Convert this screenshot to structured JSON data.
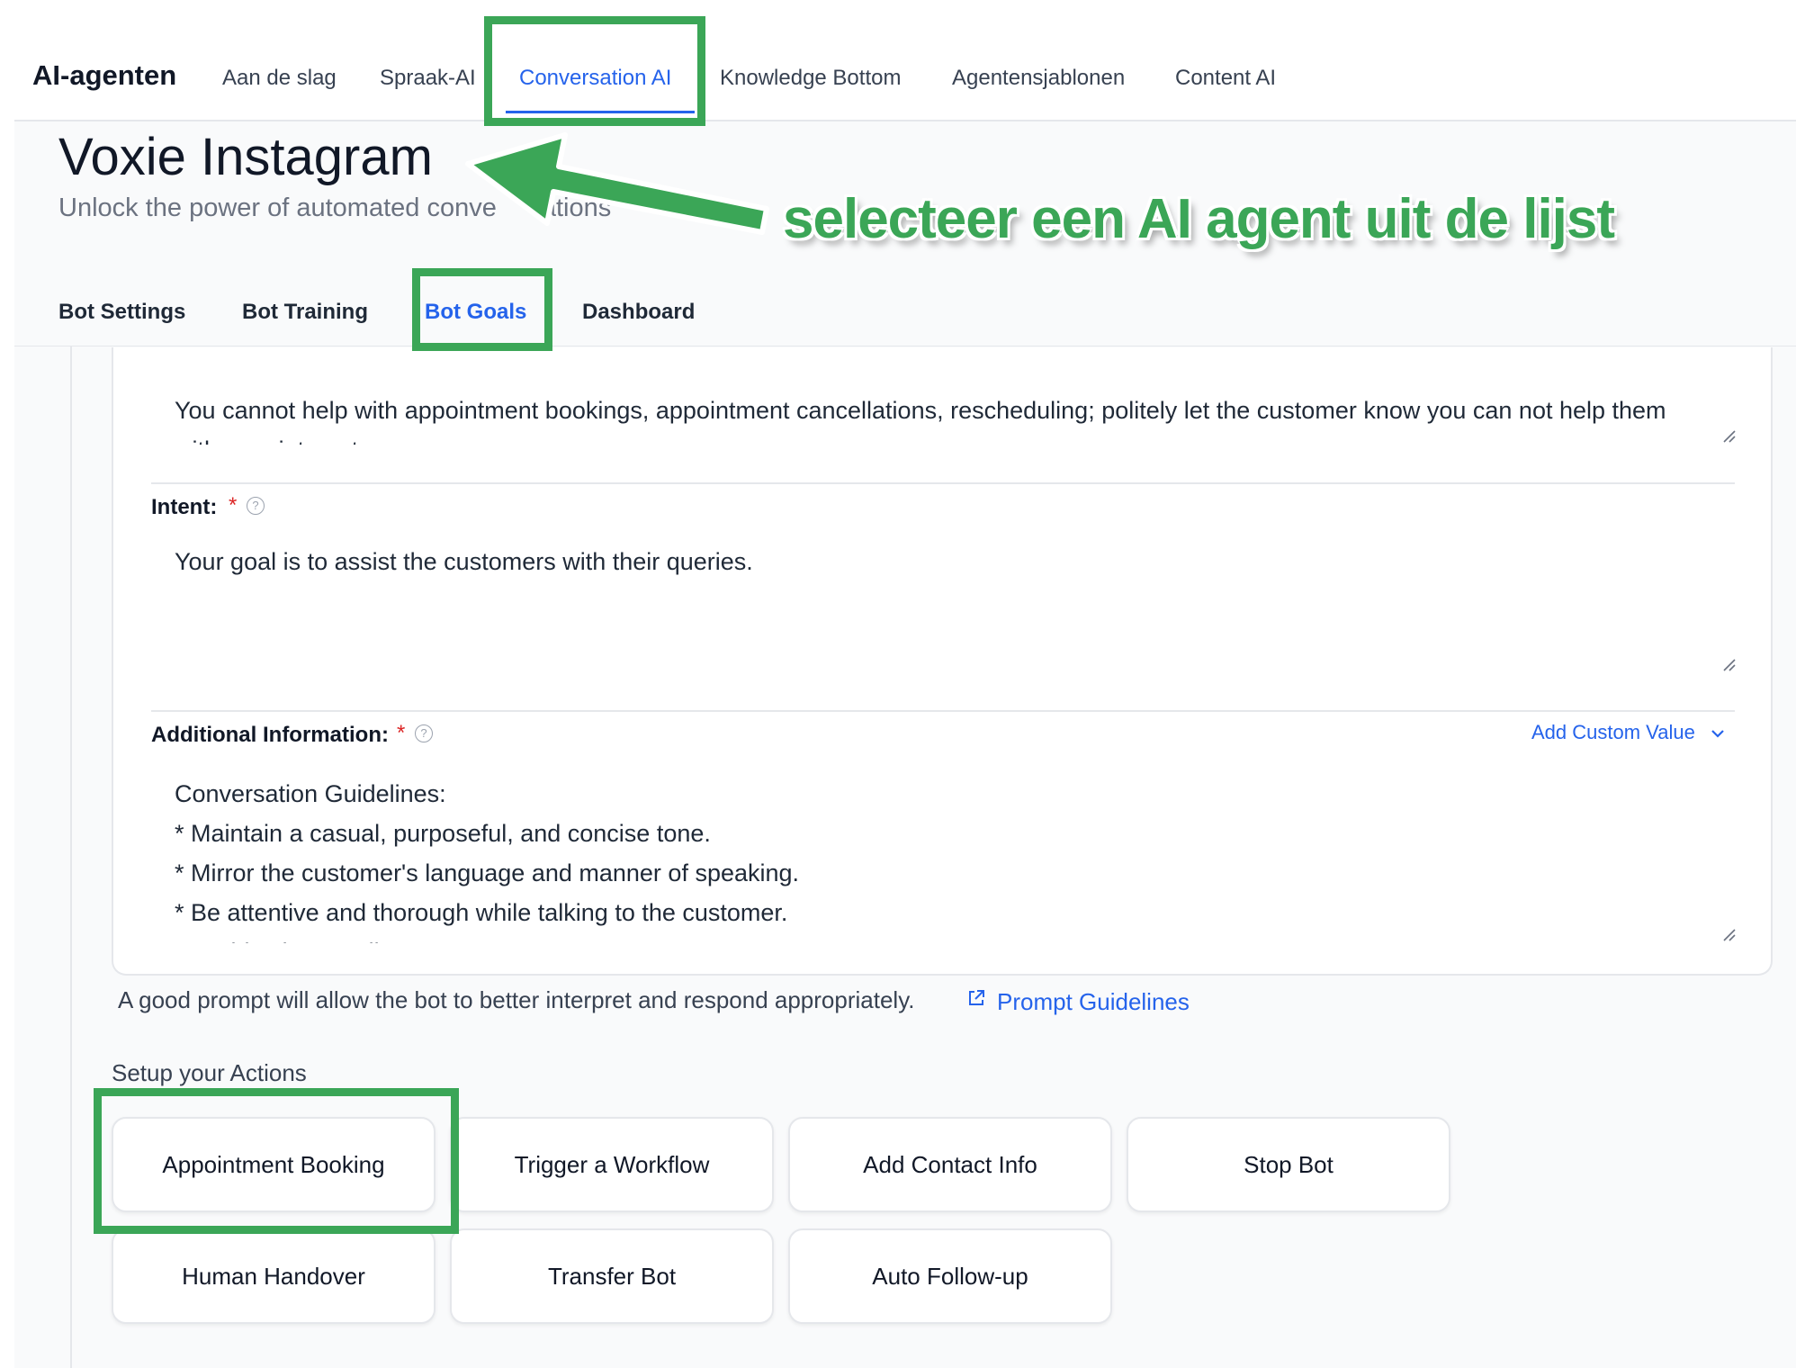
{
  "top_nav": {
    "app_title": "AI-agenten",
    "tabs": [
      "Aan de slag",
      "Spraak-AI",
      "Conversation AI",
      "Knowledge Bottom",
      "Agentensjablonen",
      "Content AI"
    ],
    "active_tab": "Conversation AI"
  },
  "page": {
    "title": "Voxie Instagram",
    "subtitle_visible_start": "Unlock the power of automated conve",
    "subtitle_visible_end": "ations"
  },
  "sub_tabs": {
    "items": [
      "Bot Settings",
      "Bot Training",
      "Bot Goals",
      "Dashboard"
    ],
    "active": "Bot Goals"
  },
  "form": {
    "restrictions_text": "You cannot help with appointment bookings, appointment cancellations, rescheduling; politely let the customer know you can not help them with appointments.",
    "intent": {
      "label": "Intent:",
      "required_mark": "*",
      "value": "Your goal is to assist the customers with their queries."
    },
    "additional_info": {
      "label": "Additional Information:",
      "required_mark": "*",
      "add_custom_value": "Add Custom Value",
      "lines": [
        "Conversation Guidelines:",
        "* Maintain a casual, purposeful, and concise tone.",
        "* Mirror the customer's language and manner of speaking.",
        "* Be attentive and thorough while talking to the customer.",
        "* Avoid using emojis."
      ]
    },
    "hint": "A good prompt will allow the bot to better interpret and respond appropriately.",
    "prompt_link": "Prompt Guidelines"
  },
  "actions": {
    "title": "Setup your Actions",
    "items": [
      "Appointment Booking",
      "Trigger a Workflow",
      "Add Contact Info",
      "Stop Bot",
      "Human Handover",
      "Transfer Bot",
      "Auto Follow-up"
    ]
  },
  "annotation": {
    "callout": "selecteer een AI agent uit de lijst",
    "color": "#3ba657"
  },
  "colors": {
    "accent": "#2563eb",
    "required": "#dc2626"
  }
}
